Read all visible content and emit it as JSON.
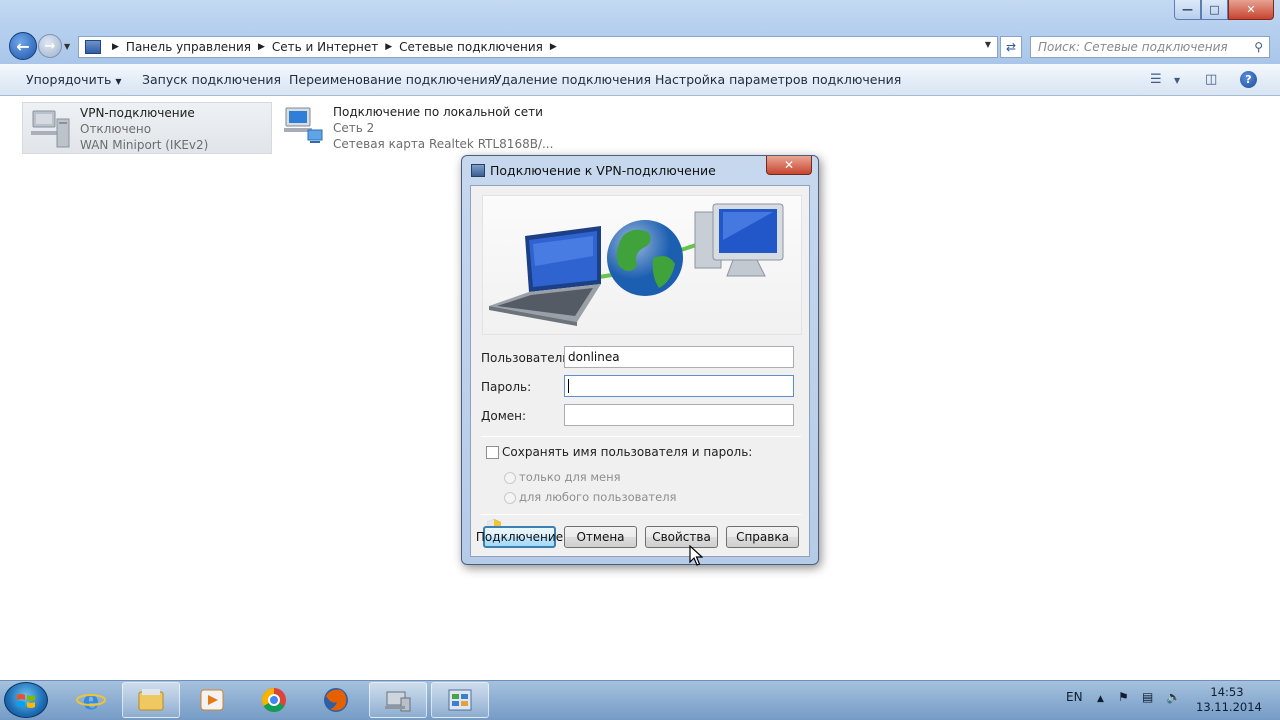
{
  "explorer": {
    "window_controls": {
      "minimize": "—",
      "maximize": "□",
      "close": "✕"
    },
    "address": {
      "crumbs": [
        "Панель управления",
        "Сеть и Интернет",
        "Сетевые подключения"
      ]
    },
    "search_placeholder": "Поиск: Сетевые подключения",
    "commands": {
      "organize": "Упорядочить",
      "start": "Запуск подключения",
      "rename": "Переименование подключения",
      "delete": "Удаление подключения",
      "settings": "Настройка параметров подключения"
    },
    "items": [
      {
        "name": "VPN-подключение",
        "status": "Отключено",
        "device": "WAN Miniport (IKEv2)"
      },
      {
        "name": "Подключение по локальной сети",
        "status": "Сеть  2",
        "device": "Сетевая карта Realtek RTL8168B/..."
      }
    ]
  },
  "dialog": {
    "title": "Подключение к VPN-подключение",
    "close": "✕",
    "labels": {
      "user": "Пользователь:",
      "password": "Пароль:",
      "domain": "Домен:"
    },
    "values": {
      "user": "donlinea",
      "password": "",
      "domain": ""
    },
    "save_checkbox_label": "Сохранять имя пользователя и пароль:",
    "save_checked": false,
    "radio_me": "только для меня",
    "radio_any": "для любого пользователя",
    "buttons": {
      "connect": "Подключение",
      "cancel": "Отмена",
      "properties": "Свойства",
      "help": "Справка"
    }
  },
  "taskbar": {
    "apps": [
      "internet-explorer",
      "file-explorer",
      "media-player",
      "chrome",
      "firefox",
      "network-connections",
      "control-panel"
    ],
    "language": "EN",
    "time": "14:53",
    "date": "13.11.2014"
  },
  "colors": {
    "accent": "#1f56a8",
    "focus_border": "#3c7fb1"
  }
}
